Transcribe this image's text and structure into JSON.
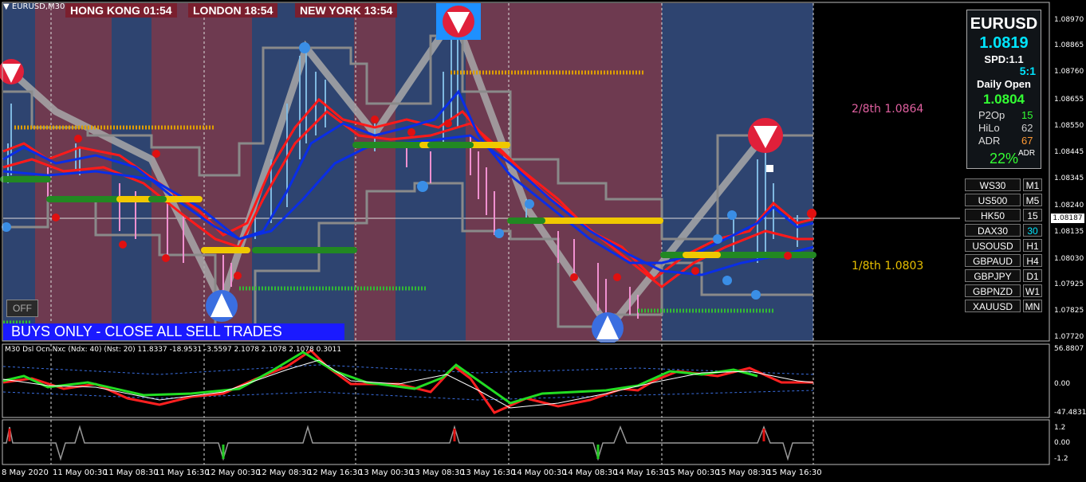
{
  "window": {
    "symbol_title": "EURUSD,M30"
  },
  "sessions": [
    {
      "label": "HONG KONG 01:54"
    },
    {
      "label": "LONDON  18:54"
    },
    {
      "label": "NEW YORK  13:54"
    }
  ],
  "banner": {
    "text": "BUYS ONLY - CLOSE ALL SELL TRADES"
  },
  "off_button": {
    "label": "OFF"
  },
  "info_box": {
    "symbol": "EURUSD",
    "price": "1.0819",
    "spread": "SPD:1.1",
    "ratio": "5:1",
    "daily_open_label": "Daily Open",
    "daily_open": "1.0804",
    "rows": [
      {
        "label": "P2Op",
        "value": "15",
        "color": "#33ff33"
      },
      {
        "label": "HiLo",
        "value": "62",
        "color": "#cccccc"
      },
      {
        "label": "ADR",
        "value": "67",
        "color": "#ff9933"
      }
    ],
    "adr_percent": "22%",
    "adr_small": "ADR"
  },
  "symbol_buttons": [
    {
      "symbol": "WS30",
      "tf": "M1"
    },
    {
      "symbol": "US500",
      "tf": "M5"
    },
    {
      "symbol": "HK50",
      "tf": "15"
    },
    {
      "symbol": "DAX30",
      "tf": "30"
    },
    {
      "symbol": "USOUSD",
      "tf": "H1"
    },
    {
      "symbol": "GBPAUD",
      "tf": "H4"
    },
    {
      "symbol": "GBPJPY",
      "tf": "D1"
    },
    {
      "symbol": "GBPNZD",
      "tf": "W1"
    },
    {
      "symbol": "XAUUSD",
      "tf": "MN"
    }
  ],
  "fib_levels": [
    {
      "label": "2/8th  1.0864",
      "color": "#e060a0"
    },
    {
      "label": "1/8th  1.0803",
      "color": "#e8c000"
    }
  ],
  "current_price_tag": "1.08187",
  "price_axis": [
    "1.08970",
    "1.08865",
    "1.08760",
    "1.08655",
    "1.08550",
    "1.08445",
    "1.08345",
    "1.08240",
    "1.08135",
    "1.08030",
    "1.07925",
    "1.07825",
    "1.07720"
  ],
  "osc_title": "M30 Dsl Ocn Nxc (Ndx: 40) (Nst: 20) 11.8337 -18.9531 -3.5597 2.1078 2.1078 2.1078 0.3011",
  "osc_axis": [
    "56.8807",
    "0.00",
    "-47.4831"
  ],
  "sig_axis": [
    "1.2",
    "0.00",
    "-1.2"
  ],
  "time_axis": [
    "8 May 2020",
    "11 May 00:30",
    "11 May 08:30",
    "11 May 16:30",
    "12 May 00:30",
    "12 May 08:30",
    "12 May 16:30",
    "13 May 00:30",
    "13 May 08:30",
    "13 May 16:30",
    "14 May 00:30",
    "14 May 08:30",
    "14 May 16:30",
    "15 May 00:30",
    "15 May 08:30",
    "15 May 16:30"
  ],
  "colors": {
    "bear_zone": "#6e3a50",
    "bull_zone": "#2e4470",
    "ma_red": "#ff1a1a",
    "ma_blue": "#0a2ee6",
    "grey_band": "#9a9a9a"
  }
}
